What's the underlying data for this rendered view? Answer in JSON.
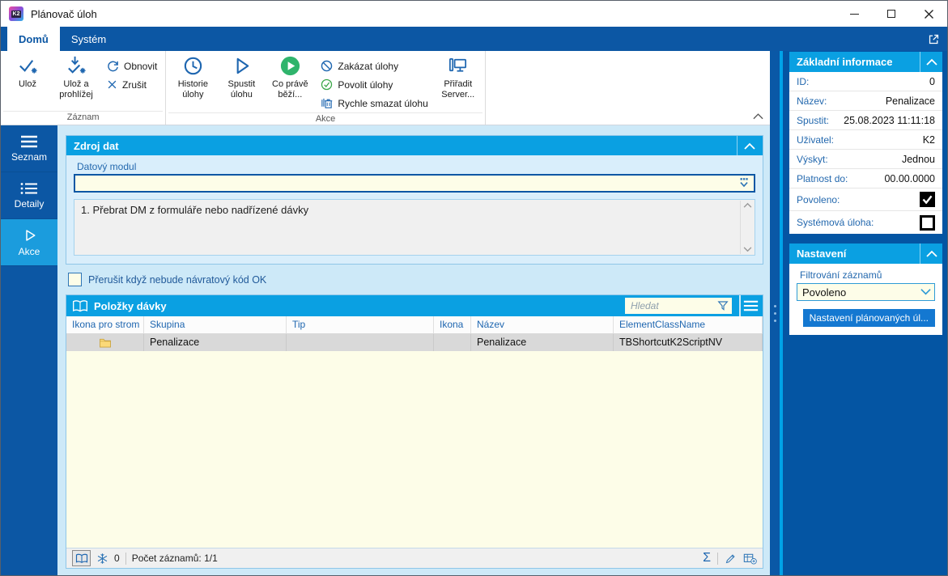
{
  "colors": {
    "dark_blue": "#0C57A4",
    "bright_header_blue": "#0AA0E2",
    "cyan_edge": "#00A3E8",
    "sidebar_selected": "#1B9CDD",
    "page_bg": "#CDE9F8",
    "pale_yellow_field": "#FDFDE8",
    "row_gray": "#D9D9D9",
    "run_green": "#2FB46C",
    "icon_blue": "#1E66B0"
  },
  "window": {
    "title": "Plánovač úloh"
  },
  "tabs": {
    "home": "Domů",
    "system": "Systém"
  },
  "ribbon": {
    "zaznam": {
      "label": "Záznam",
      "save": "Ulož",
      "save_view": "Ulož a prohlížej",
      "refresh": "Obnovit",
      "cancel": "Zrušit"
    },
    "akce": {
      "label": "Akce",
      "history": "Historie úlohy",
      "run": "Spustit úlohu",
      "running": "Co právě běží...",
      "disable": "Zakázat úlohy",
      "enable": "Povolit úlohy",
      "quick_delete": "Rychle smazat úlohu",
      "assign_server": "Přiřadit Server..."
    }
  },
  "sidebar": {
    "items": [
      {
        "label": "Seznam"
      },
      {
        "label": "Detaily"
      },
      {
        "label": "Akce",
        "active": true
      }
    ]
  },
  "zdroj_dat": {
    "title": "Zdroj dat",
    "field_label": "Datový modul",
    "field_value": "",
    "list_item": "1. Přebrat DM z formuláře nebo nadřízené dávky"
  },
  "interrupt_checkbox": {
    "label": "Přerušit když nebude návratový kód OK",
    "checked": false
  },
  "polozky_davky": {
    "title": "Položky dávky",
    "search_placeholder": "Hledat",
    "columns": [
      "Ikona pro strom",
      "Skupina",
      "Tip",
      "Ikona",
      "Název",
      "ElementClassName"
    ],
    "rows": [
      {
        "ikona_pro_strom": "folder-icon",
        "skupina": "Penalizace",
        "tip": "",
        "ikona": "",
        "nazev": "Penalizace",
        "element_class_name": "TBShortcutK2ScriptNV"
      }
    ],
    "footer": {
      "frozen_count": "0",
      "records_label": "Počet záznamů: 1/1",
      "sigma_glyph": "Σ"
    }
  },
  "panel": {
    "zakladni_informace": {
      "title": "Základní informace",
      "rows": [
        {
          "label": "ID:",
          "value": "0"
        },
        {
          "label": "Název:",
          "value": "Penalizace"
        },
        {
          "label": "Spustit:",
          "value": "25.08.2023 11:11:18"
        },
        {
          "label": "Uživatel:",
          "value": "K2"
        },
        {
          "label": "Výskyt:",
          "value": "Jednou"
        },
        {
          "label": "Platnost do:",
          "value": "00.00.0000"
        }
      ],
      "check_rows": [
        {
          "label": "Povoleno:",
          "checked": true
        },
        {
          "label": "Systémová úloha:",
          "checked": false
        }
      ]
    },
    "nastaveni": {
      "title": "Nastavení",
      "filter_label": "Filtrování záznamů",
      "filter_value": "Povoleno",
      "settings_button": "Nastavení plánovaných úl..."
    }
  },
  "icons": {
    "logo_text": "K2"
  }
}
